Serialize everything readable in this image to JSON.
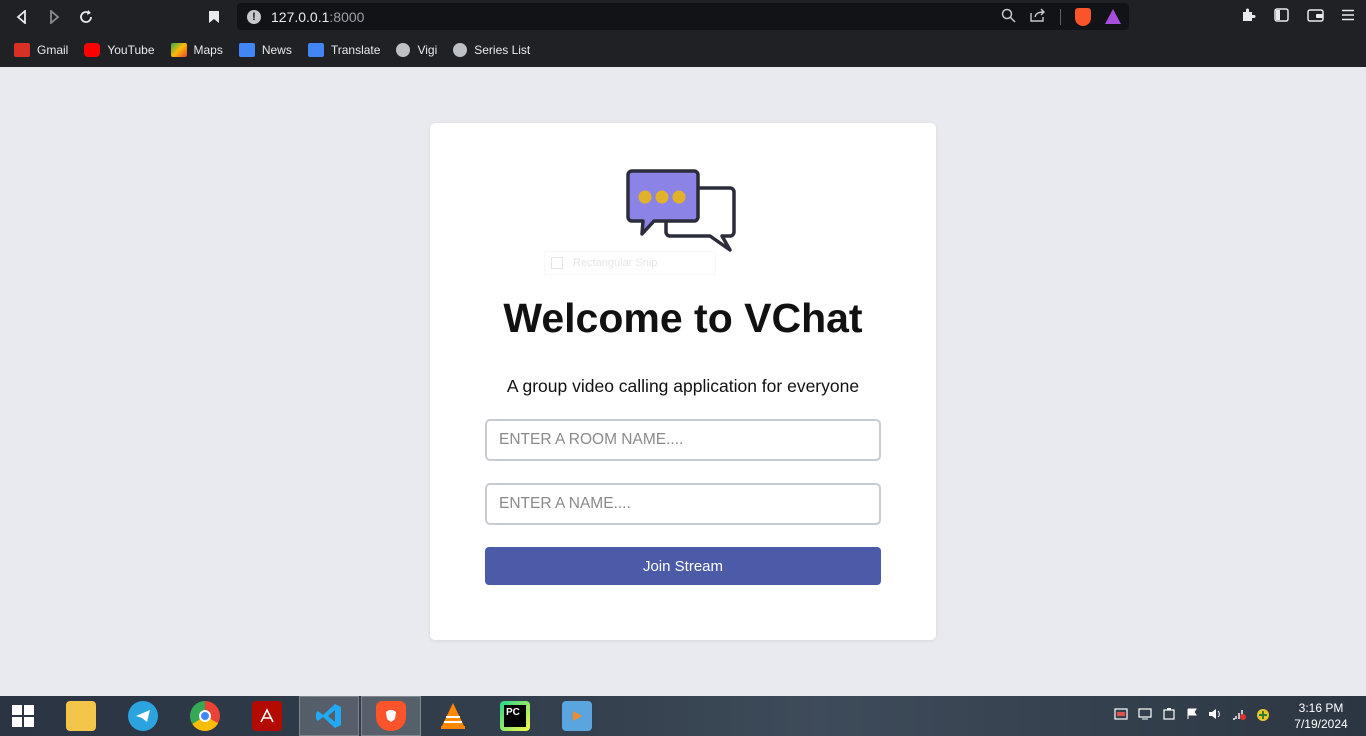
{
  "browser": {
    "url_host": "127.0.0.1",
    "url_port": ":8000",
    "bookmarks": [
      {
        "label": "Gmail",
        "color": "#d93025"
      },
      {
        "label": "YouTube",
        "color": "#ff0000"
      },
      {
        "label": "Maps",
        "color": "#34a853"
      },
      {
        "label": "News",
        "color": "#4285f4"
      },
      {
        "label": "Translate",
        "color": "#4285f4"
      },
      {
        "label": "Vigi",
        "color": "#bdc1c6"
      },
      {
        "label": "Series List",
        "color": "#bdc1c6"
      }
    ]
  },
  "page": {
    "title": "Welcome to VChat",
    "subtitle": "A group video calling application for everyone",
    "room_placeholder": "ENTER A ROOM NAME....",
    "name_placeholder": "ENTER A NAME....",
    "join_label": "Join Stream",
    "snip_text": "Rectangular Snip",
    "accent_color": "#4b5ba8",
    "logo_bubble_color": "#8b84e6",
    "logo_dot_color": "#e0b22a"
  },
  "taskbar": {
    "apps": [
      {
        "name": "file-explorer"
      },
      {
        "name": "telegram"
      },
      {
        "name": "chrome"
      },
      {
        "name": "acrobat"
      },
      {
        "name": "vscode"
      },
      {
        "name": "brave"
      },
      {
        "name": "vlc"
      },
      {
        "name": "pycharm"
      },
      {
        "name": "media-player"
      }
    ],
    "time": "3:16 PM",
    "date": "7/19/2024"
  }
}
